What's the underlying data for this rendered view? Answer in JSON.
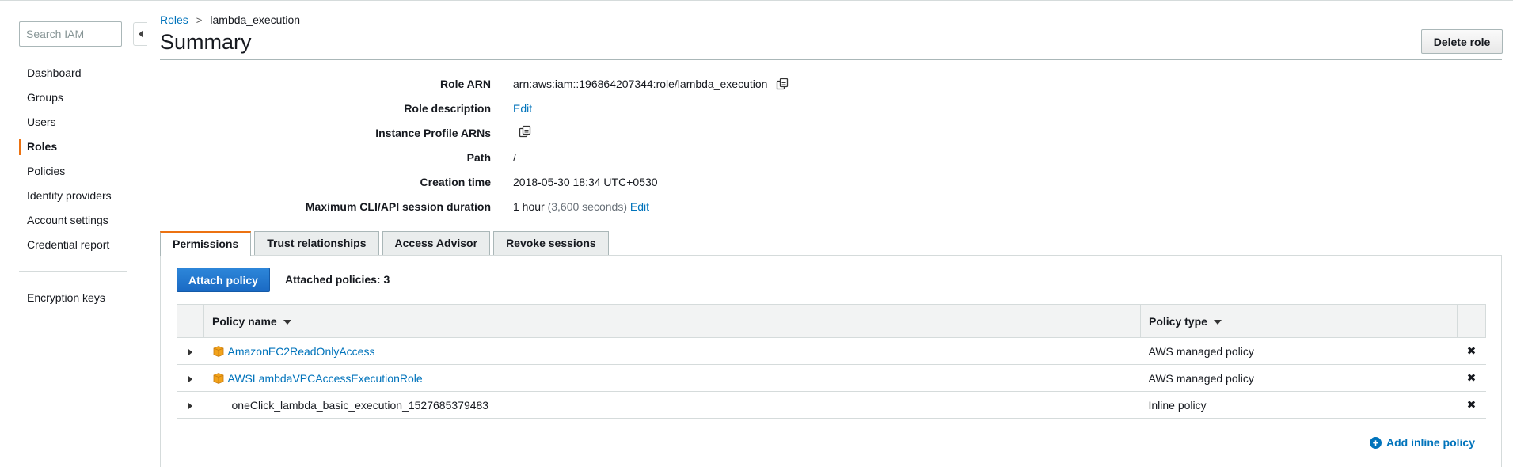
{
  "sidebar": {
    "search_placeholder": "Search IAM",
    "items": [
      {
        "label": "Dashboard",
        "active": false
      },
      {
        "label": "Groups",
        "active": false
      },
      {
        "label": "Users",
        "active": false
      },
      {
        "label": "Roles",
        "active": true
      },
      {
        "label": "Policies",
        "active": false
      },
      {
        "label": "Identity providers",
        "active": false
      },
      {
        "label": "Account settings",
        "active": false
      },
      {
        "label": "Credential report",
        "active": false
      }
    ],
    "extra_items": [
      {
        "label": "Encryption keys"
      }
    ]
  },
  "breadcrumb": {
    "parent": "Roles",
    "separator": ">",
    "current": "lambda_execution"
  },
  "header": {
    "title": "Summary",
    "delete_label": "Delete role"
  },
  "details": {
    "role_arn_label": "Role ARN",
    "role_arn_value": "arn:aws:iam::196864207344:role/lambda_execution",
    "role_description_label": "Role description",
    "role_description_link": "Edit",
    "instance_profile_label": "Instance Profile ARNs",
    "path_label": "Path",
    "path_value": "/",
    "creation_time_label": "Creation time",
    "creation_time_value": "2018-05-30 18:34 UTC+0530",
    "max_session_label": "Maximum CLI/API session duration",
    "max_session_value": "1 hour",
    "max_session_detail": "(3,600 seconds)",
    "max_session_link": "Edit"
  },
  "tabs": [
    {
      "label": "Permissions",
      "active": true
    },
    {
      "label": "Trust relationships",
      "active": false
    },
    {
      "label": "Access Advisor",
      "active": false
    },
    {
      "label": "Revoke sessions",
      "active": false
    }
  ],
  "permissions": {
    "attach_label": "Attach policy",
    "attached_count_text": "Attached policies: 3",
    "columns": {
      "name": "Policy name",
      "type": "Policy type"
    },
    "rows": [
      {
        "name": "AmazonEC2ReadOnlyAccess",
        "type": "AWS managed policy",
        "managed": true
      },
      {
        "name": "AWSLambdaVPCAccessExecutionRole",
        "type": "AWS managed policy",
        "managed": true
      },
      {
        "name": "oneClick_lambda_basic_execution_1527685379483",
        "type": "Inline policy",
        "managed": false
      }
    ],
    "remove_glyph": "✖",
    "add_inline_label": "Add inline policy"
  },
  "colors": {
    "link": "#0073bb",
    "accent": "#ec7211",
    "primary_button": "#1a6ac4"
  }
}
